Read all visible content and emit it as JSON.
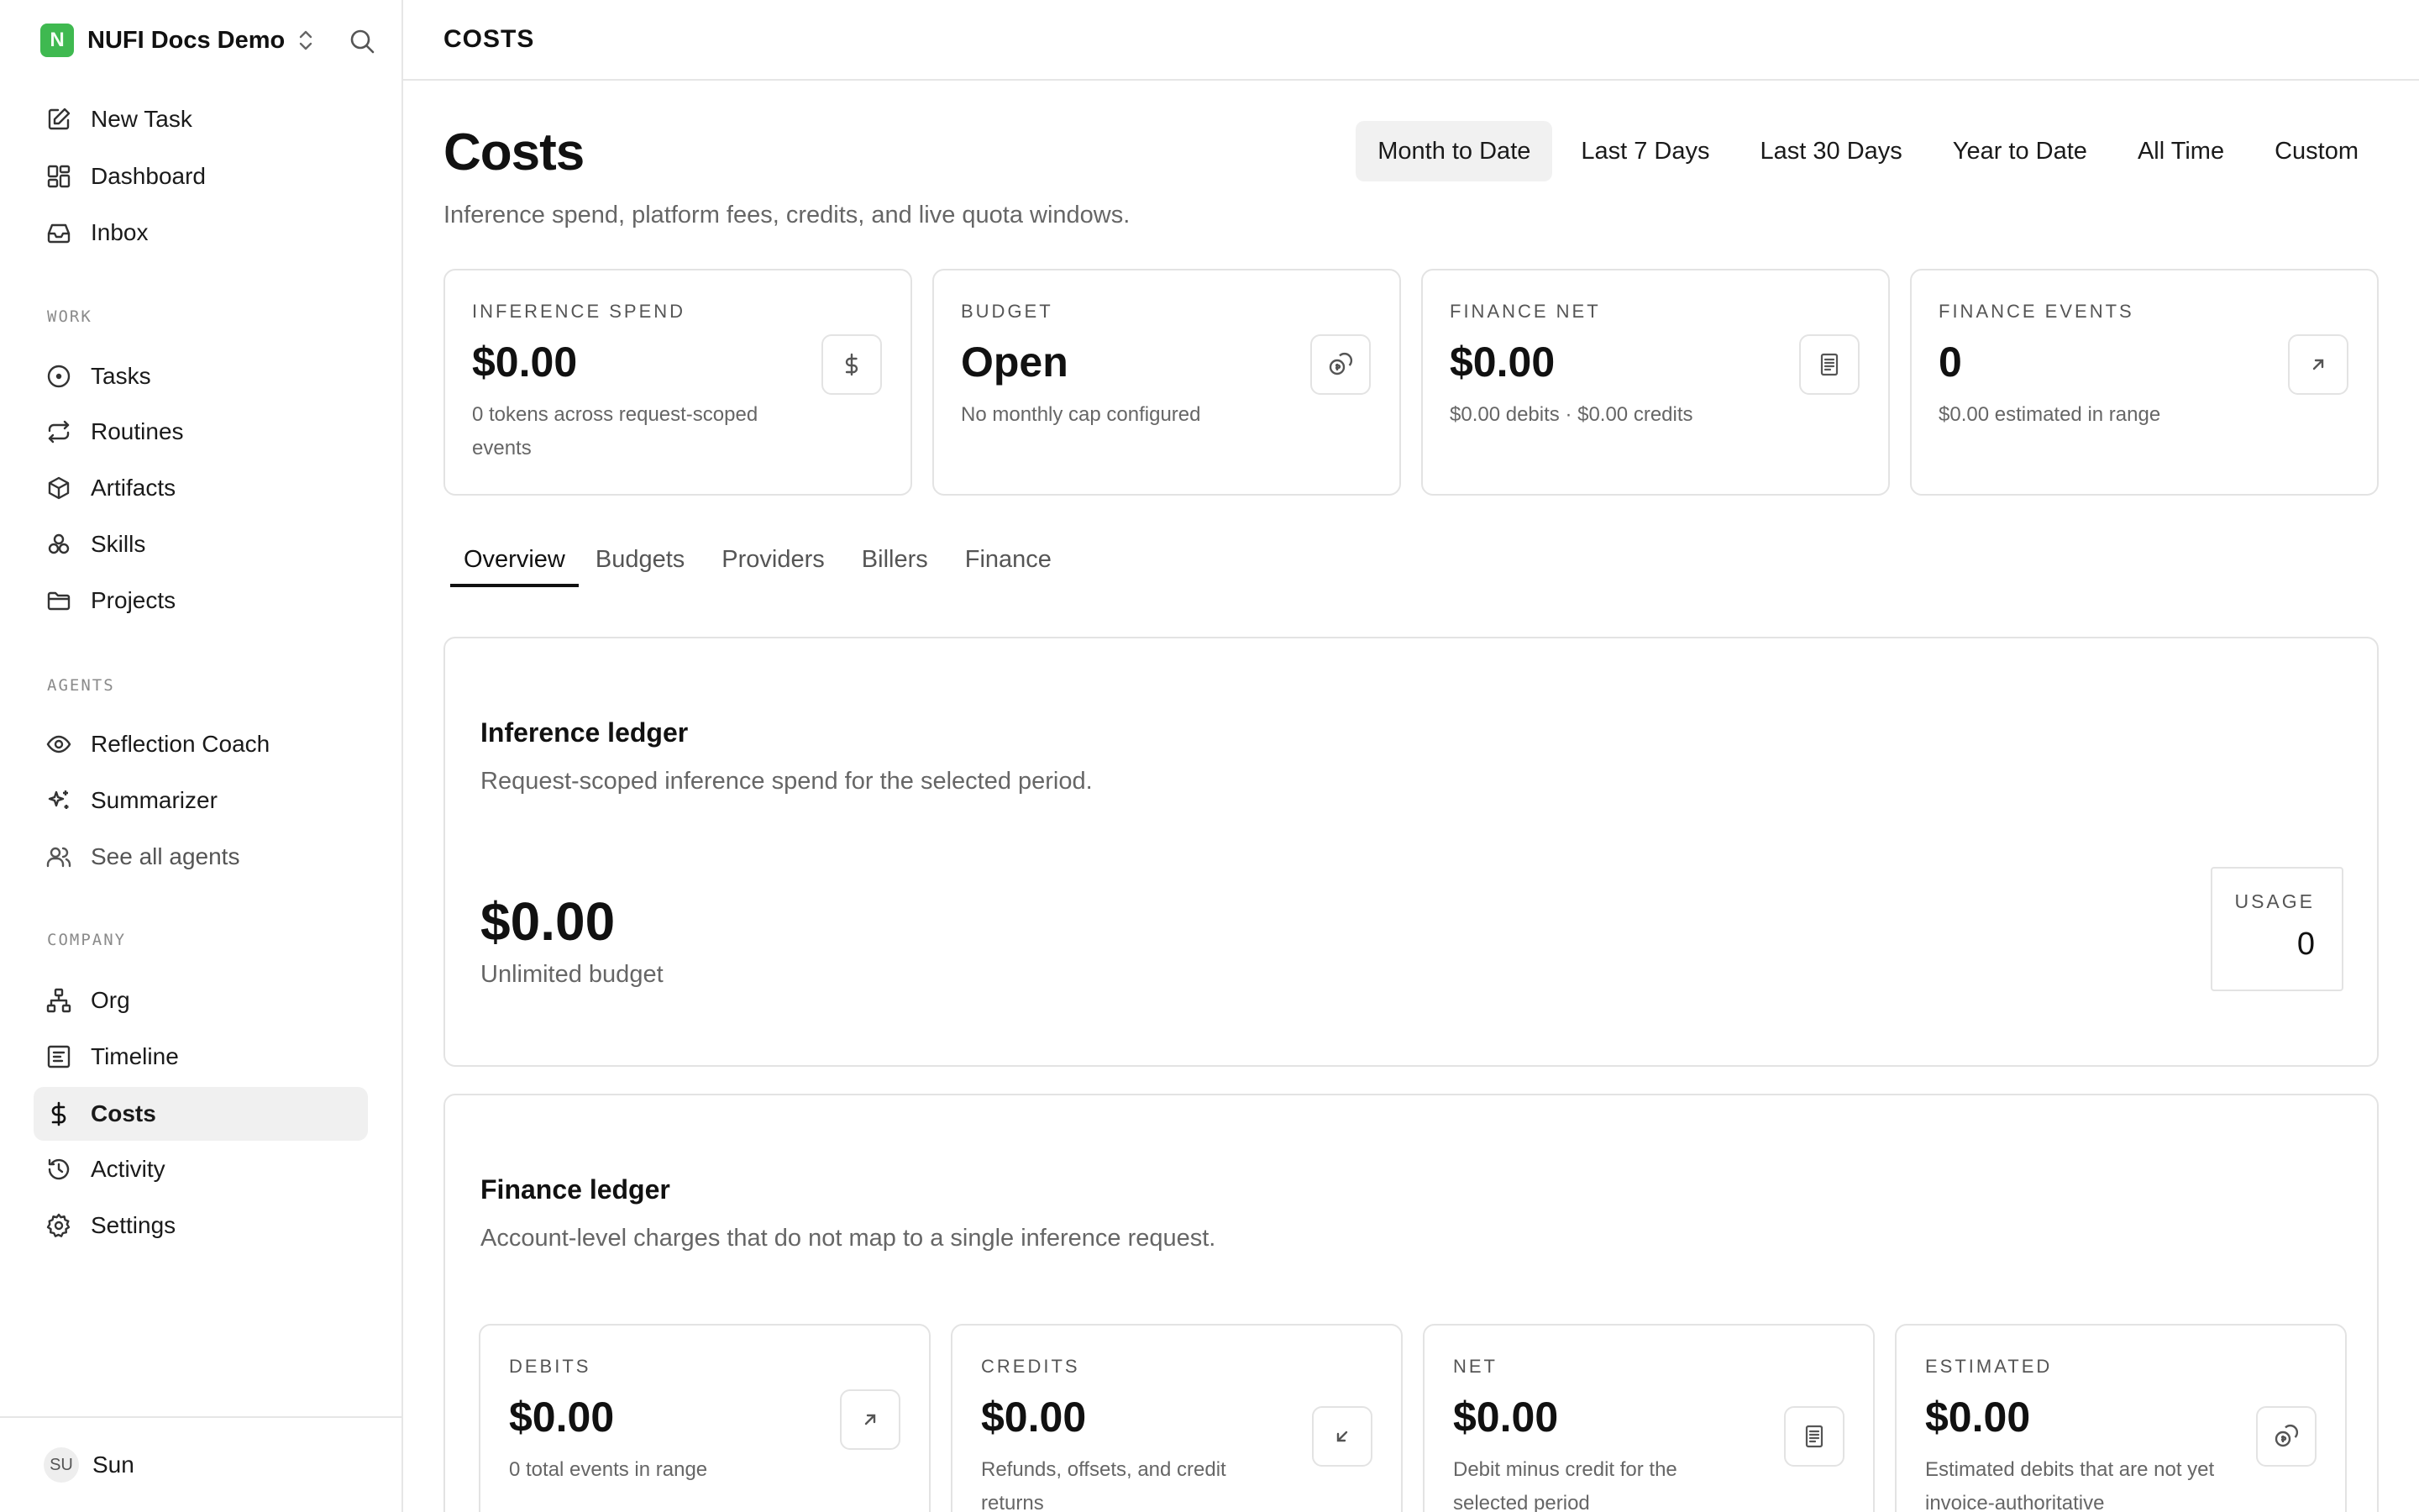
{
  "sidebar": {
    "workspace_initial": "N",
    "workspace_name": "NUFI Docs Demo",
    "top_items": [
      {
        "label": "New Task",
        "icon": "edit-icon"
      },
      {
        "label": "Dashboard",
        "icon": "dashboard-icon"
      },
      {
        "label": "Inbox",
        "icon": "inbox-icon"
      }
    ],
    "sections": {
      "work": "WORK",
      "agents": "AGENTS",
      "company": "COMPANY"
    },
    "work_items": [
      {
        "label": "Tasks",
        "icon": "circle-dot-icon"
      },
      {
        "label": "Routines",
        "icon": "repeat-icon"
      },
      {
        "label": "Artifacts",
        "icon": "package-icon"
      },
      {
        "label": "Skills",
        "icon": "boxes-icon"
      },
      {
        "label": "Projects",
        "icon": "folder-icon"
      }
    ],
    "agent_items": [
      {
        "label": "Reflection Coach",
        "icon": "eye-icon"
      },
      {
        "label": "Summarizer",
        "icon": "sparkles-icon"
      },
      {
        "label": "See all agents",
        "icon": "users-icon"
      }
    ],
    "company_items": [
      {
        "label": "Org",
        "icon": "network-icon"
      },
      {
        "label": "Timeline",
        "icon": "timeline-icon"
      },
      {
        "label": "Costs",
        "icon": "dollar-icon",
        "active": true
      },
      {
        "label": "Activity",
        "icon": "history-icon"
      },
      {
        "label": "Settings",
        "icon": "gear-icon"
      }
    ],
    "user": {
      "initials": "SU",
      "name": "Sun"
    }
  },
  "topbar": {
    "title": "COSTS"
  },
  "page": {
    "title": "Costs",
    "subtitle": "Inference spend, platform fees, credits, and live quota windows.",
    "ranges": [
      "Month to Date",
      "Last 7 Days",
      "Last 30 Days",
      "Year to Date",
      "All Time",
      "Custom"
    ],
    "active_range": "Month to Date"
  },
  "summary_cards": [
    {
      "label": "INFERENCE SPEND",
      "value": "$0.00",
      "desc": "0 tokens across request-scoped events",
      "icon": "dollar-icon"
    },
    {
      "label": "BUDGET",
      "value": "Open",
      "desc": "No monthly cap configured",
      "icon": "coins-icon"
    },
    {
      "label": "FINANCE NET",
      "value": "$0.00",
      "desc": "$0.00 debits · $0.00 credits",
      "icon": "receipt-icon"
    },
    {
      "label": "FINANCE EVENTS",
      "value": "0",
      "desc": "$0.00 estimated in range",
      "icon": "arrow-up-right-icon"
    }
  ],
  "tabs": [
    "Overview",
    "Budgets",
    "Providers",
    "Billers",
    "Finance"
  ],
  "inference_ledger": {
    "title": "Inference ledger",
    "subtitle": "Request-scoped inference spend for the selected period.",
    "value": "$0.00",
    "value_sub": "Unlimited budget",
    "usage_label": "USAGE",
    "usage_value": "0"
  },
  "finance_ledger": {
    "title": "Finance ledger",
    "subtitle": "Account-level charges that do not map to a single inference request.",
    "cards": [
      {
        "label": "DEBITS",
        "value": "$0.00",
        "desc": "0 total events in range",
        "icon": "arrow-up-right-icon"
      },
      {
        "label": "CREDITS",
        "value": "$0.00",
        "desc": "Refunds, offsets, and credit returns",
        "icon": "arrow-down-left-icon"
      },
      {
        "label": "NET",
        "value": "$0.00",
        "desc": "Debit minus credit for the selected period",
        "icon": "receipt-icon"
      },
      {
        "label": "ESTIMATED",
        "value": "$0.00",
        "desc": "Estimated debits that are not yet invoice-authoritative",
        "icon": "coins-icon"
      }
    ]
  }
}
